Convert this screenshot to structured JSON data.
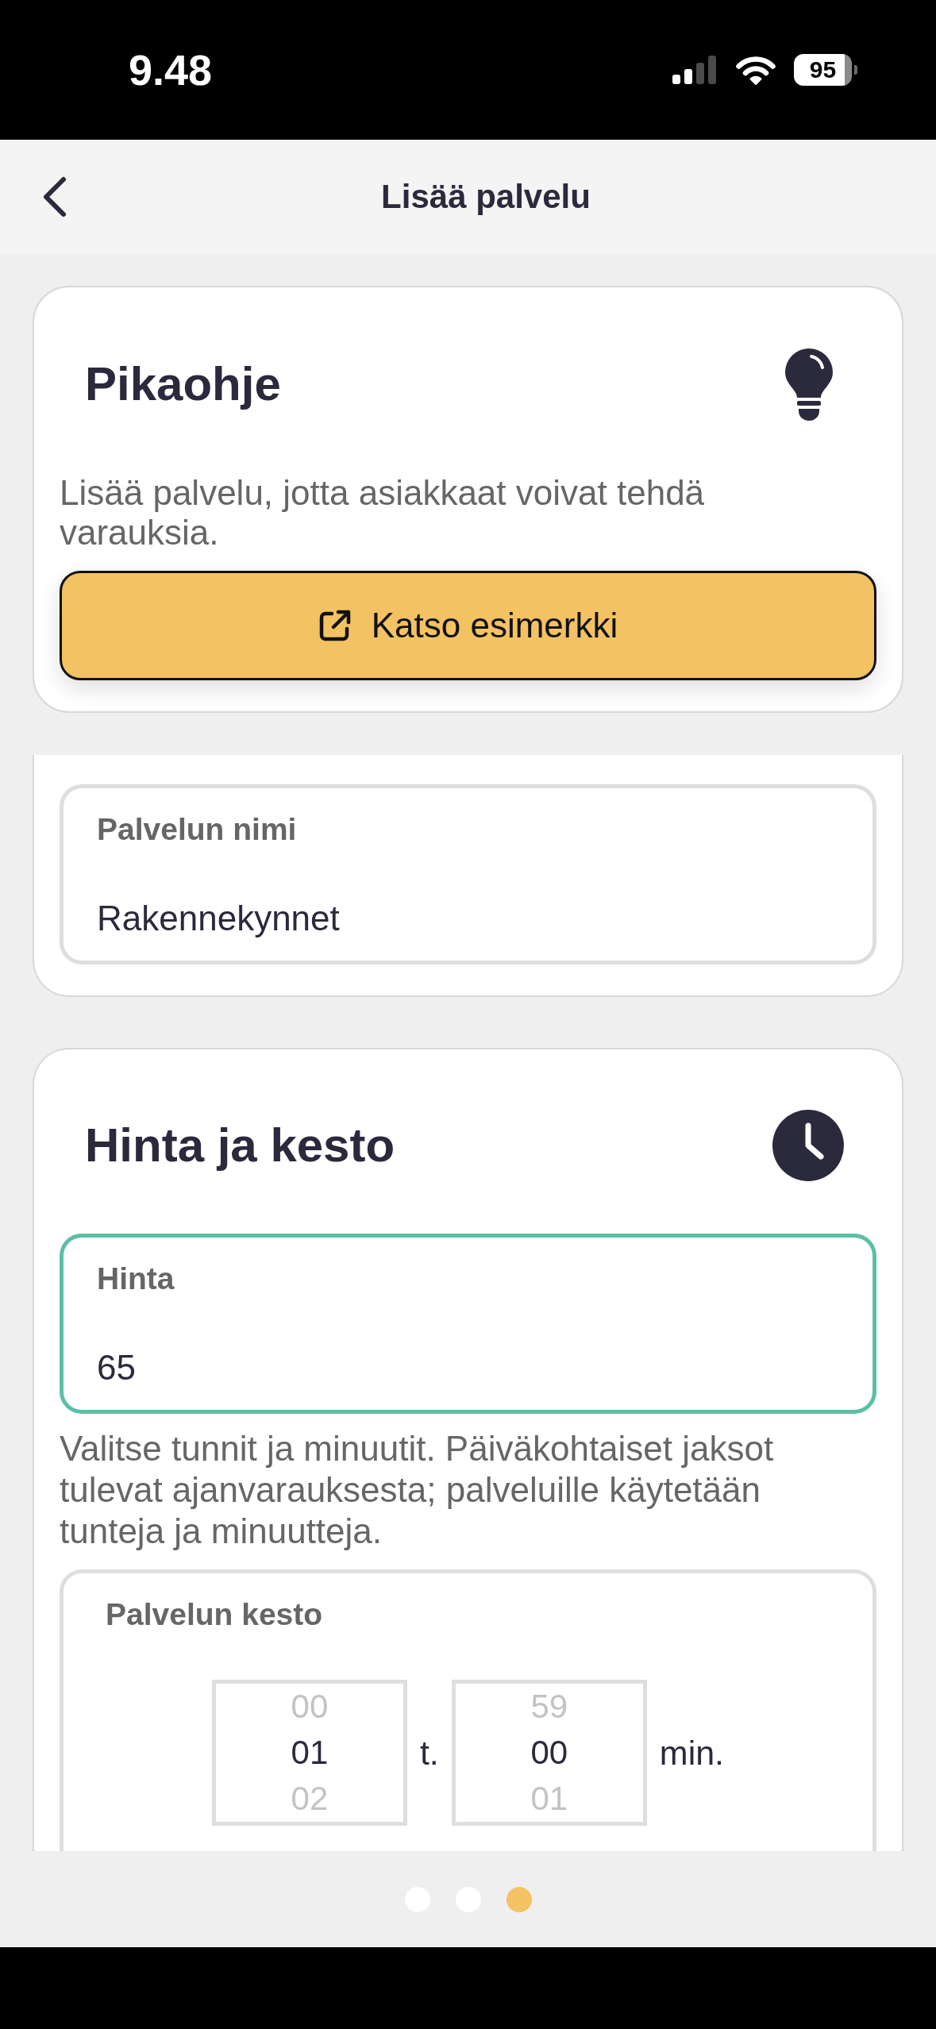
{
  "status_bar": {
    "time": "9.48",
    "battery": "95"
  },
  "header": {
    "title": "Lisää palvelu"
  },
  "quick_guide": {
    "title": "Pikaohje",
    "description": "Lisää palvelu, jotta asiakkaat voivat tehdä varauksia.",
    "button": "Katso esimerkki"
  },
  "service_name": {
    "field": {
      "label": "Palvelun nimi",
      "value": "Rakennekynnet",
      "focused": false
    }
  },
  "price_duration": {
    "title": "Hinta ja kesto",
    "price_field": {
      "label": "Hinta",
      "value": "65",
      "focused": true
    },
    "help_text": "Valitse tunnit ja minuutit. Päiväkohtaiset jaksot tulevat ajanvarauksesta; palveluille käytetään tunteja ja minuutteja.",
    "duration": {
      "label": "Palvelun kesto",
      "pickers": [
        {
          "options": [
            {
              "text": "00",
              "selected": false
            },
            {
              "text": "01",
              "selected": true
            },
            {
              "text": "02",
              "selected": false
            }
          ],
          "unit": "t."
        },
        {
          "options": [
            {
              "text": "59",
              "selected": false
            },
            {
              "text": "00",
              "selected": true
            },
            {
              "text": "01",
              "selected": false
            }
          ],
          "unit": "min."
        }
      ]
    }
  },
  "page_indicator": [
    {
      "selected": false
    },
    {
      "selected": false
    },
    {
      "selected": true
    }
  ]
}
